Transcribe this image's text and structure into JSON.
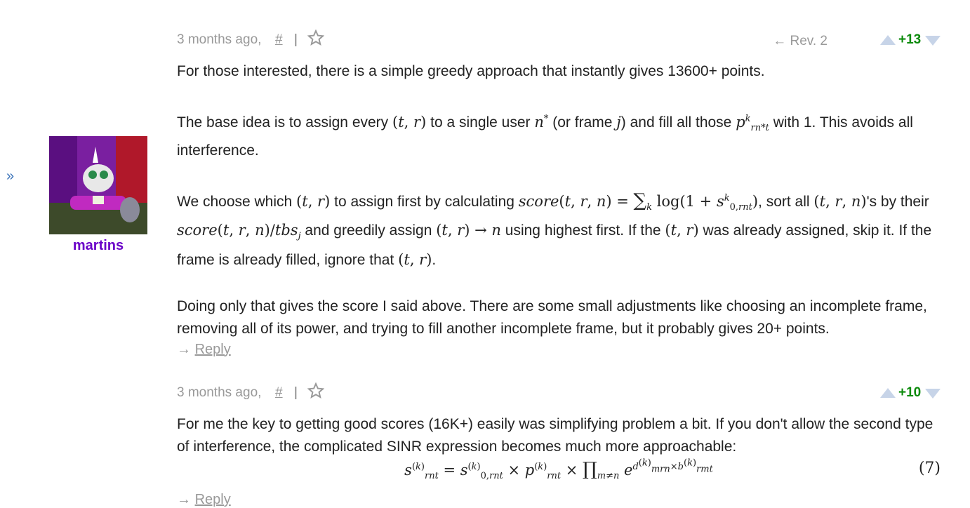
{
  "sidebar": {
    "expand_glyph": "»",
    "author": "martins"
  },
  "comment1": {
    "time": "3 months ago,",
    "hash": "#",
    "sep": "|",
    "revision": "Rev. 2",
    "score": "+13",
    "p1": "For those interested, there is a simple greedy approach that instantly gives 13600+ points.",
    "p2_a": "The base idea is to assign every ",
    "p2_b": " to a single user ",
    "p2_c": " (or frame ",
    "p2_d": ") and fill all those ",
    "p2_e": " with 1. This avoids all interference.",
    "p3_a": "We choose which ",
    "p3_b": " to assign first by calculating ",
    "p3_c": ", sort all ",
    "p3_d": "'s by their ",
    "p3_e": " and greedily assign ",
    "p3_f": " using highest first. If the ",
    "p3_g": " was already assigned, skip it. If the frame is already filled, ignore that ",
    "p3_h": ".",
    "p4": "Doing only that gives the score I said above. There are some small adjustments like choosing an incomplete frame, removing all of its power, and trying to fill another incomplete frame, but it probably gives 20+ points.",
    "reply": "Reply"
  },
  "comment2": {
    "time": "3 months ago,",
    "hash": "#",
    "sep": "|",
    "score": "+10",
    "p1": "For me the key to getting good scores (16K+) easily was simplifying problem a bit. If you don't allow the second type of interference, the complicated SINR expression becomes much more approachable:",
    "eq_number": "(7)",
    "reply": "Reply"
  },
  "colors": {
    "author": "#6a00c8",
    "score": "#0a8a0a",
    "vote_arrow": "#c7d4e8",
    "meta": "#999999"
  },
  "icons": {
    "favorite": "star-outline-icon",
    "vote_up": "triangle-up-icon",
    "vote_down": "triangle-down-icon",
    "revision_arrow": "left-arrow-icon",
    "reply_arrow": "right-arrow-icon"
  }
}
